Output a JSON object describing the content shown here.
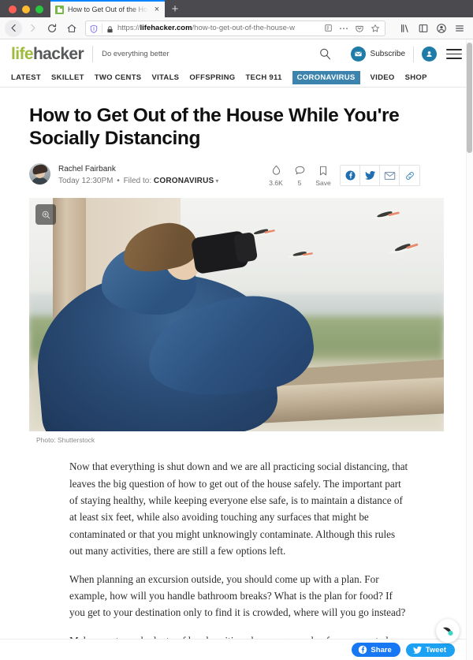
{
  "browser": {
    "tab": {
      "title": "How to Get Out of the House W",
      "close_label": "×",
      "favicon_name": "lifehacker-favicon"
    },
    "new_tab_label": "+",
    "nav": {
      "back_label": "←",
      "forward_label": "→",
      "reload_label": "⟳",
      "home_label": "⌂"
    },
    "url": {
      "scheme": "https://",
      "domain": "lifehacker.com",
      "path": "/how-to-get-out-of-the-house-w",
      "full": "https://lifehacker.com/how-to-get-out-of-the-house-w"
    },
    "toolbar": {
      "reader_label": "▤",
      "more_label": "⋯",
      "pocket_label": "♥",
      "bookmark_label": "☆",
      "library_label": "‖",
      "sidebar_label": "◫",
      "account_label": "●",
      "menu_label": "☰"
    }
  },
  "site": {
    "logo": {
      "part1": "life",
      "part2": "hacker"
    },
    "tagline": "Do everything better",
    "subscribe_label": "Subscribe",
    "nav_items": [
      {
        "label": "LATEST",
        "active": false
      },
      {
        "label": "SKILLET",
        "active": false
      },
      {
        "label": "TWO CENTS",
        "active": false
      },
      {
        "label": "VITALS",
        "active": false
      },
      {
        "label": "OFFSPRING",
        "active": false
      },
      {
        "label": "TECH 911",
        "active": false
      },
      {
        "label": "CORONAVIRUS",
        "active": true
      },
      {
        "label": "VIDEO",
        "active": false
      },
      {
        "label": "SHOP",
        "active": false
      }
    ],
    "accent_color": "#3c84ad",
    "logo_green": "#9fbb3b"
  },
  "article": {
    "headline": "How to Get Out of the House While You're Socially Distancing",
    "author": "Rachel Fairbank",
    "timestamp": "Today 12:30PM",
    "filed_to_prefix": "Filed to:",
    "filed_to": "CORONAVIRUS",
    "actions": {
      "views_count": "3.6K",
      "comments_count": "5",
      "save_label": "Save"
    },
    "image_caption": "Photo: Shutterstock",
    "paragraphs": [
      "Now that everything is shut down and we are all practicing social distancing, that leaves the big question of how to get out of the house safely. The important part of staying healthy, while keeping everyone else safe, is to maintain a distance of at least six feet, while also avoiding touching any surfaces that might be contaminated or that you might unknowingly contaminate. Although this rules out many activities, there are still a few options left.",
      "When planning an excursion outside, you should come up with a plan. For example, how will you handle bathroom breaks? What is the plan for food? If you get to your destination only to find it is crowded, where will you go instead?",
      "Make sure to pack plenty of hand sanitizer, have a game plan for unexpected circumstances, and above all, if you or anyone in your family feels even slightly"
    ]
  },
  "bottom_bar": {
    "facebook_label": "Share",
    "twitter_label": "Tweet"
  }
}
